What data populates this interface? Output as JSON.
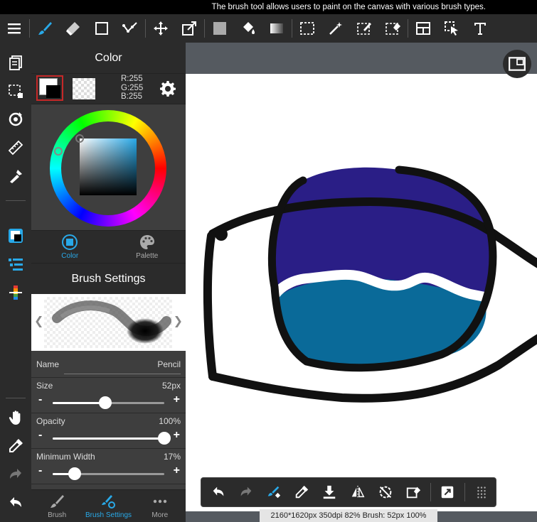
{
  "tooltip": "The brush tool allows users to paint on the canvas with various brush types.",
  "color_panel": {
    "title": "Color",
    "rgb": {
      "r": "R:255",
      "g": "G:255",
      "b": "B:255"
    },
    "tabs": [
      {
        "label": "Color",
        "active": true
      },
      {
        "label": "Palette",
        "active": false
      }
    ]
  },
  "brush_settings": {
    "title": "Brush Settings",
    "name_label": "Name",
    "name_value": "Pencil",
    "size": {
      "label": "Size",
      "value": "52px",
      "level": 0.47
    },
    "opacity": {
      "label": "Opacity",
      "value": "100%",
      "level": 1.0
    },
    "min_width": {
      "label": "Minimum Width",
      "value": "17%",
      "level": 0.2
    }
  },
  "bottom_tabs": [
    {
      "label": "Brush",
      "active": false
    },
    {
      "label": "Brush Settings",
      "active": true
    },
    {
      "label": "More",
      "active": false
    }
  ],
  "status": "2160*1620px 350dpi 82% Brush: 52px 100%",
  "colors": {
    "accent": "#29a9e8",
    "iris_top": "#2a1e86",
    "iris_bottom": "#0a6a99",
    "outline": "#111111"
  }
}
